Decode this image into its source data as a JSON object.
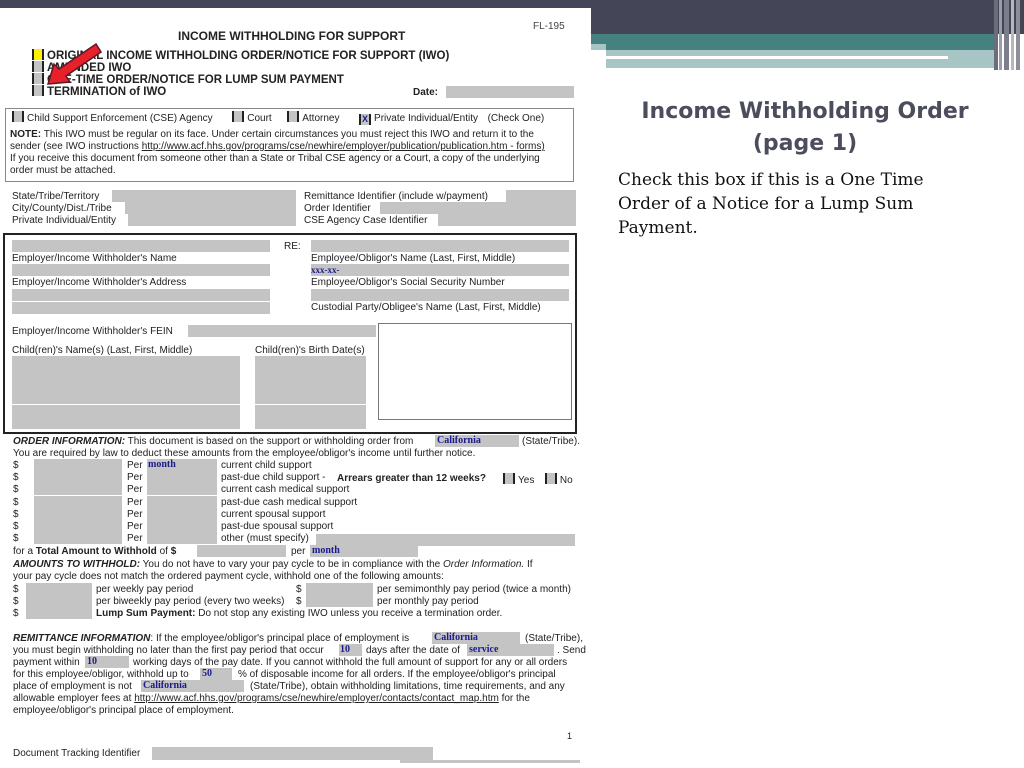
{
  "slide": {
    "title_line1": "Income Withholding Order",
    "title_line2": "(page 1)",
    "body": "Check this box if this is a One Time Order of a Notice for a Lump Sum Payment.",
    "colors": {
      "dark_bar": "#444657",
      "teal": "#45827f",
      "teal_light": "#a8c5c6",
      "title": "#4b4d5c"
    }
  },
  "form": {
    "form_id": "FL-195",
    "title": "INCOME WITHHOLDING FOR SUPPORT",
    "iwo_options": [
      {
        "label": "ORIGINAL INCOME WITHHOLDING ORDER/NOTICE FOR SUPPORT (IWO)",
        "highlighted": true
      },
      {
        "label": "AMENDED IWO",
        "highlighted": false
      },
      {
        "label": "ONE-TIME ORDER/NOTICE FOR LUMP SUM PAYMENT",
        "highlighted": false
      },
      {
        "label": "TERMINATION of IWO",
        "highlighted": false
      }
    ],
    "date_label": "Date:",
    "sender_types": {
      "cse_agency": "Child Support Enforcement (CSE) Agency",
      "court": "Court",
      "attorney": "Attorney",
      "private": "Private Individual/Entity",
      "private_mark": "X",
      "check_one": "(Check One)"
    },
    "note": {
      "label": "NOTE:",
      "line1": "This IWO must be regular on its face. Under certain circumstances you must reject this IWO and return it to the",
      "line2_pre": "sender (see IWO instructions ",
      "line2_link": "http://www.acf.hhs.gov/programs/cse/newhire/employer/publication/publication.htm - forms)",
      "line3": "If you receive this document from someone other than a State or Tribal CSE agency or a Court, a copy of the underlying",
      "line4": "order must be attached."
    },
    "identifiers": {
      "state": "State/Tribe/Territory",
      "city": "City/County/Dist./Tribe",
      "private": "Private Individual/Entity",
      "remittance": "Remittance Identifier (include w/payment)",
      "order": "Order Identifier",
      "case": "CSE Agency Case Identifier"
    },
    "parties": {
      "re": "RE:",
      "employer_name": "Employer/Income Withholder's Name",
      "employer_address": "Employer/Income Withholder's Address",
      "employee_name": "Employee/Obligor's Name (Last, First, Middle)",
      "ssn_value": "xxx-xx-",
      "ssn_label": "Employee/Obligor's Social Security Number",
      "custodial": "Custodial Party/Obligee's Name (Last, First, Middle)",
      "fein": "Employer/Income Withholder's FEIN",
      "children_names": "Child(ren)'s Name(s) (Last, First, Middle)",
      "children_dob": "Child(ren)'s Birth Date(s)"
    },
    "order_info": {
      "label": "ORDER INFORMATION:",
      "text": "This document is based on the support or withholding order from",
      "state_value": "California",
      "state_suffix": "(State/Tribe).",
      "line2": "You are required by law to deduct these amounts from the employee/obligor's income until further notice.",
      "rows": [
        {
          "per_value": "month",
          "desc": "current child support"
        },
        {
          "per_value": "",
          "desc": "past-due child support -"
        },
        {
          "per_value": "",
          "desc": "current cash medical support"
        },
        {
          "per_value": "",
          "desc": "past-due cash medical support"
        },
        {
          "per_value": "",
          "desc": "current spousal support"
        },
        {
          "per_value": "",
          "desc": "past-due spousal support"
        },
        {
          "per_value": "",
          "desc": "other (must specify)"
        }
      ],
      "dollar": "$",
      "per": "Per",
      "arrears_q": "Arrears greater than 12 weeks?",
      "yes": "Yes",
      "no": "No",
      "total_pre": "for a ",
      "total_bold": "Total Amount to Withhold",
      "total_of": " of ",
      "total_dollar": "$",
      "total_per": "per",
      "total_per_value": "month"
    },
    "amounts": {
      "label": "AMOUNTS TO WITHHOLD:",
      "text1": "You do not have to vary your pay cycle to be in compliance with the",
      "text1_it": "Order Information.",
      "text1_end": "If",
      "text2": "your pay cycle does not match the ordered payment cycle, withhold one of the following amounts:",
      "weekly": "per weekly pay period",
      "semimonthly": "per semimonthly pay period (twice a month)",
      "biweekly": "per biweekly pay period (every two weeks)",
      "monthly": "per monthly pay period",
      "lump_bold": "Lump Sum Payment:",
      "lump_text": "Do not stop any existing IWO unless you receive a termination order."
    },
    "remittance": {
      "label": "REMITTANCE INFORMATION",
      "l1": ": If the employee/obligor's principal place of employment is",
      "state_value": "California",
      "state_suffix": "(State/Tribe),",
      "l2a": "you must begin withholding no later than the first pay period that occur",
      "days_value": "10",
      "l2b": "days after the date of",
      "service_value": "service",
      "l2c": ". Send",
      "l3a": "payment within",
      "working_days_value": "10",
      "l3b": "working days of the pay date. If you cannot withhold the full amount of support for any or all orders",
      "l4a": "for this employee/obligor, withhold up to",
      "percent_value": "50",
      "l4b": "% of disposable income for all orders. If the employee/obligor's principal",
      "l5a": "place of employment is not",
      "not_state_value": "California",
      "l5b": "(State/Tribe), obtain withholding limitations, time requirements, and any",
      "l6a": "allowable employer fees at",
      "l6_link": "http://www.acf.hhs.gov/programs/cse/newhire/employer/contacts/contact_map.htm",
      "l6b": "for the",
      "l7": "employee/obligor's principal place of employment."
    },
    "page_number": "1",
    "tracking_label": "Document Tracking Identifier"
  }
}
